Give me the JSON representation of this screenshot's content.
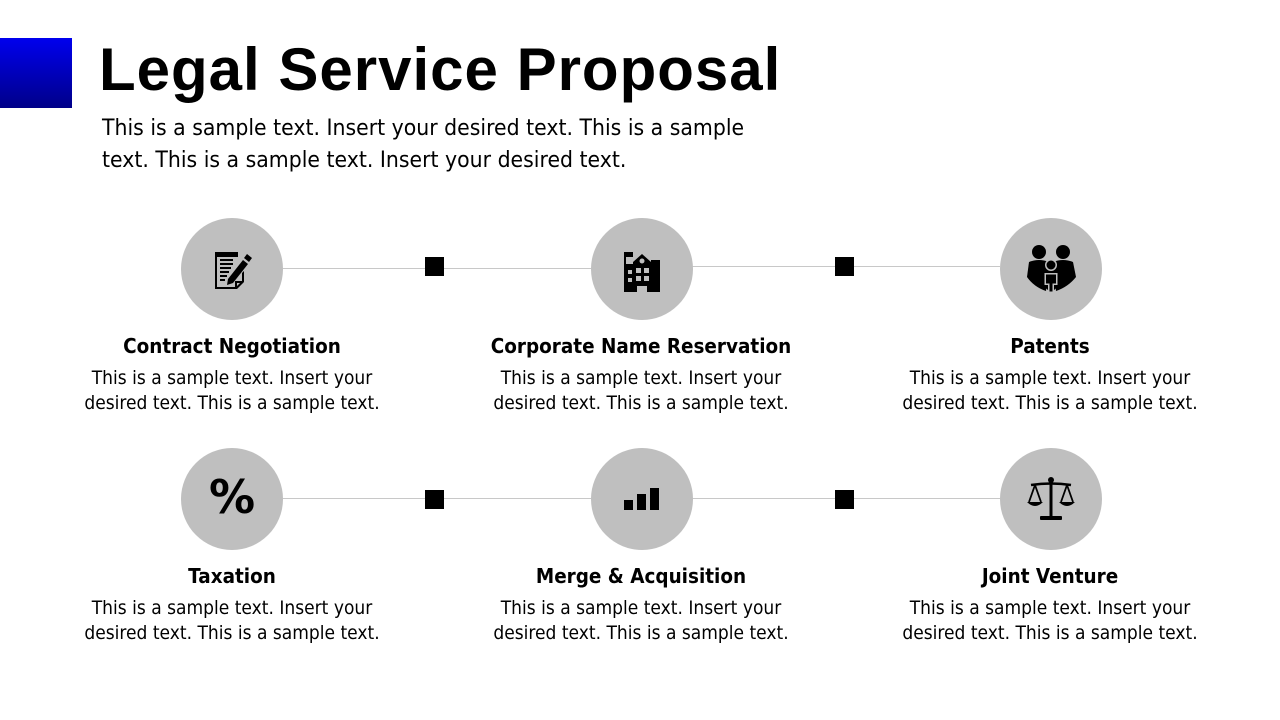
{
  "header": {
    "title": "Legal Service Proposal",
    "subtitle": "This is a sample text. Insert your desired text. This is a sample text. This is a sample text. Insert your desired text.",
    "accent_color": "#0000cc"
  },
  "services": [
    {
      "title": "Contract Negotiation",
      "text": "This is a sample text. Insert your desired text. This is a sample text.",
      "icon": "contract-edit-icon"
    },
    {
      "title": "Corporate Name Reservation",
      "text": "This is a sample text. Insert your desired text. This is a sample text.",
      "icon": "school-building-icon"
    },
    {
      "title": "Patents",
      "text": "This is a sample text. Insert your desired text. This is a sample text.",
      "icon": "family-icon"
    },
    {
      "title": "Taxation",
      "text": "This is a sample text. Insert your desired text. This is a sample text.",
      "icon": "percent-icon",
      "glyph": "%"
    },
    {
      "title": "Merge & Acquisition",
      "text": "This is a sample text. Insert your desired text. This is a sample text.",
      "icon": "bar-chart-icon"
    },
    {
      "title": "Joint Venture",
      "text": "This is a sample text. Insert your desired text. This is a sample text.",
      "icon": "scales-of-justice-icon"
    }
  ],
  "colors": {
    "circle": "#bfbfbf",
    "connector": "#c8c8c8",
    "node": "#000000"
  }
}
